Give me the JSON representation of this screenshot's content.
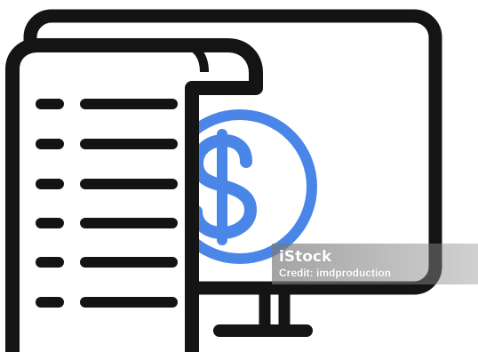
{
  "colors": {
    "outline": "#141414",
    "accent": "#4a86e8",
    "background": "#ffffff",
    "watermark_band": "#8c8c8c"
  },
  "illustration": {
    "icons": [
      "monitor-icon",
      "receipt-icon",
      "dollar-coin-icon"
    ]
  },
  "watermark": {
    "brand": "iStock",
    "credit": "Credit: imdproduction"
  }
}
